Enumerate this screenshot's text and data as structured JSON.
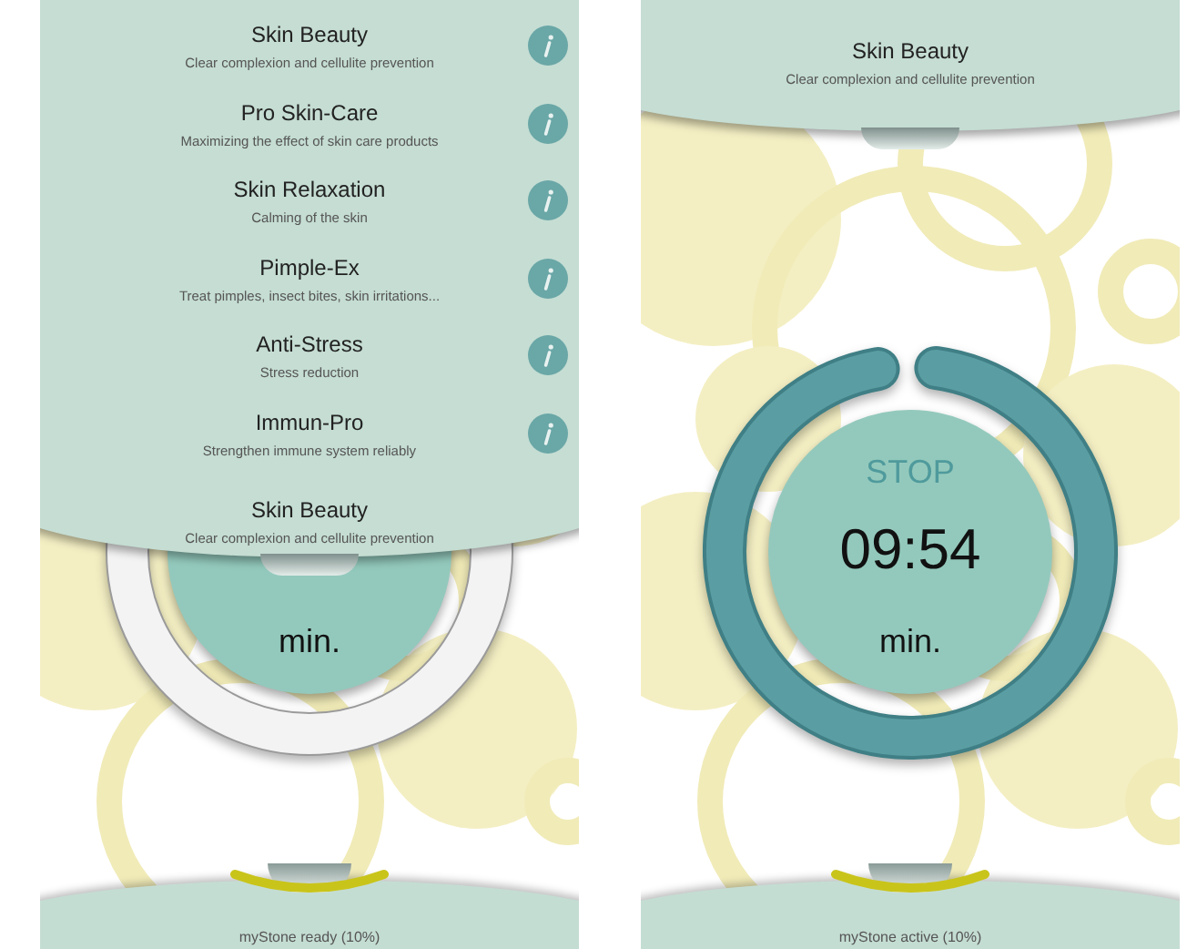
{
  "screens": [
    {
      "program_menu": [
        {
          "title": "Skin Beauty",
          "subtitle": "Clear complexion and cellulite prevention"
        },
        {
          "title": "Pro Skin-Care",
          "subtitle": "Maximizing the effect of skin care products"
        },
        {
          "title": "Skin Relaxation",
          "subtitle": "Calming of the skin"
        },
        {
          "title": "Pimple-Ex",
          "subtitle": "Treat pimples, insect bites, skin irritations..."
        },
        {
          "title": "Anti-Stress",
          "subtitle": "Stress reduction"
        },
        {
          "title": "Immun-Pro",
          "subtitle": "Strengthen immune system reliably"
        }
      ],
      "current_program": {
        "title": "Skin Beauty",
        "subtitle": "Clear complexion and cellulite prevention"
      },
      "timer": {
        "kind": "idle",
        "unit": "min."
      },
      "status": "myStone ready (10%)"
    },
    {
      "current_program": {
        "title": "Skin Beauty",
        "subtitle": "Clear complexion and cellulite prevention"
      },
      "timer": {
        "kind": "running",
        "action": "STOP",
        "time": "09:54",
        "unit": "min."
      },
      "status": "myStone active (10%)"
    }
  ]
}
